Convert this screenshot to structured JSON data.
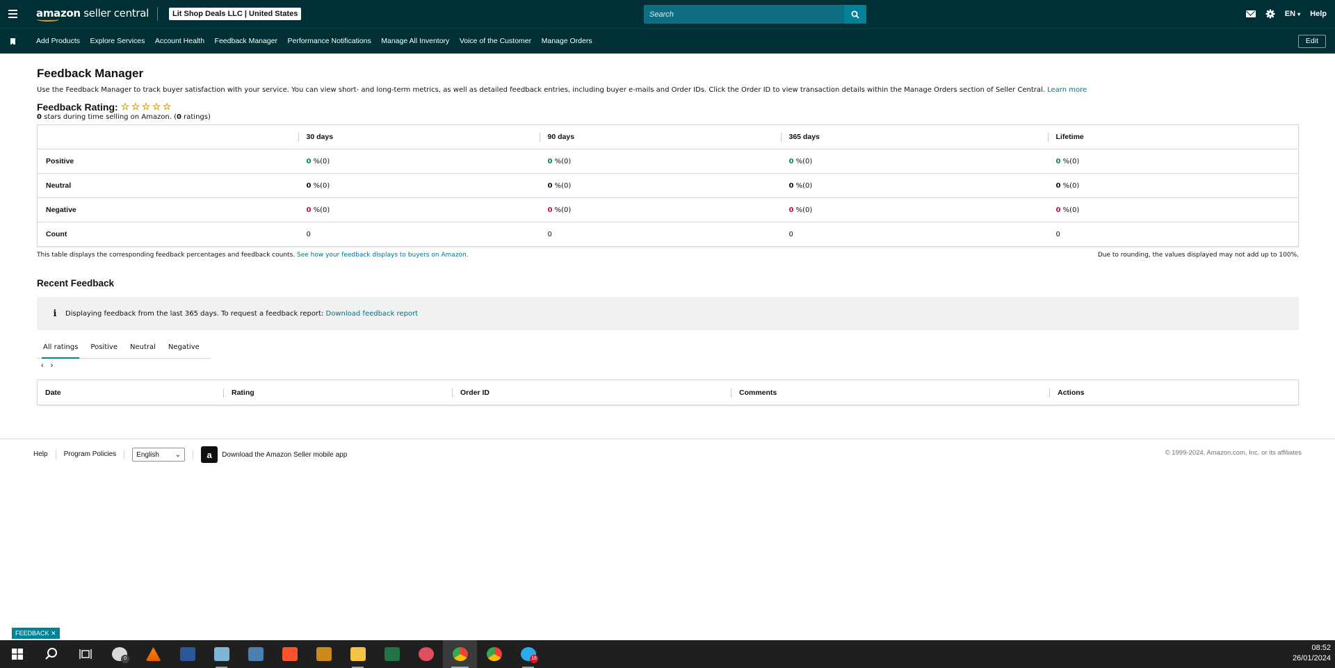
{
  "header": {
    "logo_amazon": "amazon",
    "logo_rest": " seller central",
    "account": "Lit Shop Deals LLC | United States",
    "search_placeholder": "Search",
    "language": "EN",
    "help": "Help"
  },
  "nav": {
    "items": [
      "Add Products",
      "Explore Services",
      "Account Health",
      "Feedback Manager",
      "Performance Notifications",
      "Manage All Inventory",
      "Voice of the Customer",
      "Manage Orders"
    ],
    "edit": "Edit"
  },
  "page": {
    "title": "Feedback Manager",
    "description": "Use the Feedback Manager to track buyer satisfaction with your service. You can view short- and long-term metrics, as well as detailed feedback entries, including buyer e-mails and Order IDs. Click the Order ID to view transaction details within the Manage Orders section of Seller Central.",
    "learn_more": "Learn more",
    "rating_label": "Feedback Rating:",
    "stars_count": "0",
    "stars_text": " stars during time selling on Amazon. (",
    "ratings_count": "0",
    "ratings_text": " ratings)"
  },
  "metrics": {
    "columns": [
      "30 days",
      "90 days",
      "365 days",
      "Lifetime"
    ],
    "rows": [
      {
        "label": "Positive",
        "cells": [
          "0",
          "0",
          "0",
          "0"
        ],
        "counts": [
          "%(0)",
          "%(0)",
          "%(0)",
          "%(0)"
        ],
        "tone": "green"
      },
      {
        "label": "Neutral",
        "cells": [
          "0",
          "0",
          "0",
          "0"
        ],
        "counts": [
          "%(0)",
          "%(0)",
          "%(0)",
          "%(0)"
        ],
        "tone": "neutral"
      },
      {
        "label": "Negative",
        "cells": [
          "0",
          "0",
          "0",
          "0"
        ],
        "counts": [
          "%(0)",
          "%(0)",
          "%(0)",
          "%(0)"
        ],
        "tone": "red"
      }
    ],
    "count_label": "Count",
    "count_values": [
      "0",
      "0",
      "0",
      "0"
    ],
    "note_left": "This table displays the corresponding feedback percentages and feedback counts.",
    "note_link": "See how your feedback displays to buyers on Amazon.",
    "note_right": "Due to rounding, the values displayed may not add up to 100%."
  },
  "recent": {
    "title": "Recent Feedback",
    "info_text": "Displaying feedback from the last 365 days. To request a feedback report:",
    "info_link": "Download feedback report",
    "tabs": [
      "All ratings",
      "Positive",
      "Neutral",
      "Negative"
    ],
    "columns": [
      "Date",
      "Rating",
      "Order ID",
      "Comments",
      "Actions"
    ]
  },
  "footer": {
    "help": "Help",
    "policies": "Program Policies",
    "language": "English",
    "app": "Download the Amazon Seller mobile app",
    "copyright": "© 1999-2024, Amazon.com, Inc. or its affiliates"
  },
  "feedback_tab": "FEEDBACK",
  "taskbar": {
    "time": "08:52",
    "date": "26/01/2024",
    "badge_count": "18",
    "clock_badge": "0"
  },
  "colors": {
    "header_bg": "#002f36",
    "accent": "#008296",
    "positive": "#067d62",
    "negative": "#cc0c39"
  }
}
